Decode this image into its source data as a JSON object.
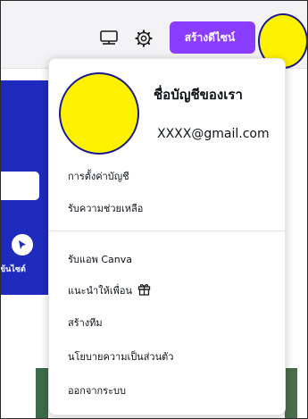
{
  "header": {
    "create_button_label": "สร้างดีไซน์",
    "icons": [
      "desktop-icon",
      "gear-icon"
    ]
  },
  "background": {
    "side_label": "ข้นไซต์",
    "accent": "#1f2bbd"
  },
  "account_menu": {
    "name": "ชื่อบัญชีของเรา",
    "email": "XXXX@gmail.com",
    "items": [
      "การตั้งค่าบัญชี",
      "รับความช่วยเหลือ",
      "รับแอพ Canva",
      "แนะนำให้เพื่อน",
      "สร้างทีม",
      "นโยบายความเป็นส่วนตัว",
      "ออกจากระบบ"
    ]
  },
  "colors": {
    "brand": "#8b3dff",
    "avatar_fill": "#fff200"
  }
}
